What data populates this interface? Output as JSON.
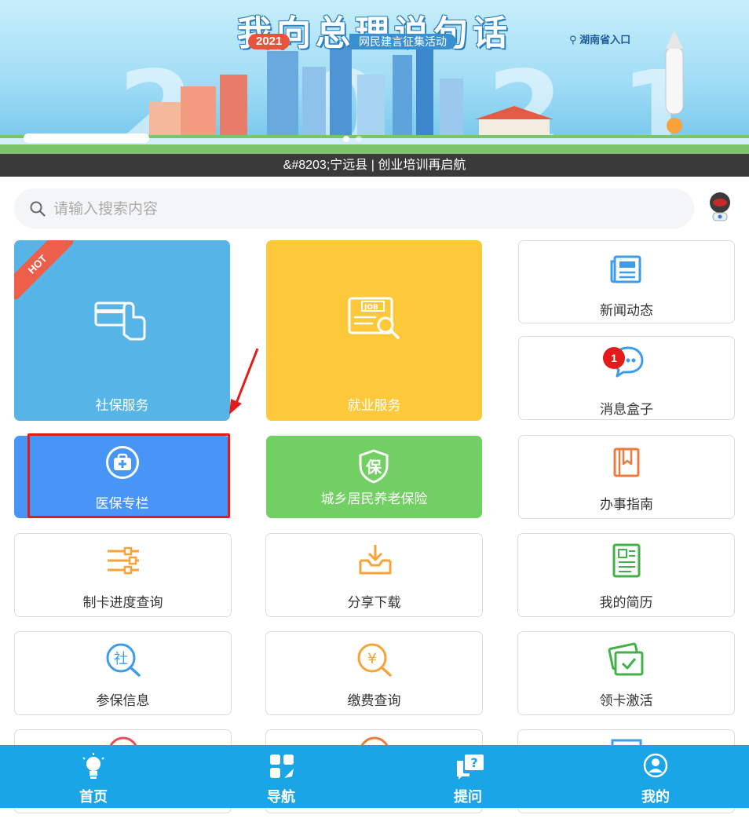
{
  "banner": {
    "title": "我向总理说句话",
    "year": "2021",
    "subtitle": "网民建言征集活动",
    "location": "湖南省入口",
    "slides": 2,
    "active_slide": 0
  },
  "news": {
    "text": "&#8203;宁远县 | 创业培训再启航"
  },
  "search": {
    "placeholder": "请输入搜索内容"
  },
  "tiles": {
    "shebao": {
      "label": "社保服务",
      "hot": "HOT"
    },
    "jiuye": {
      "label": "就业服务"
    },
    "news": {
      "label": "新闻动态"
    },
    "messages": {
      "label": "消息盒子",
      "badge": "1"
    },
    "yibao": {
      "label": "医保专栏"
    },
    "pension": {
      "label": "城乡居民养老保险",
      "icon_char": "保"
    },
    "guide": {
      "label": "办事指南"
    },
    "card_progress": {
      "label": "制卡进度查询"
    },
    "download": {
      "label": "分享下载"
    },
    "resume": {
      "label": "我的简历"
    },
    "insured_info": {
      "label": "参保信息",
      "icon_char": "社"
    },
    "payment": {
      "label": "缴费查询",
      "icon_char": "¥"
    },
    "card_activate": {
      "label": "领卡激活"
    }
  },
  "bottom_nav": {
    "items": [
      {
        "label": "首页"
      },
      {
        "label": "导航"
      },
      {
        "label": "提问"
      },
      {
        "label": "我的"
      }
    ]
  },
  "colors": {
    "accent_blue": "#1aa6e6",
    "tile_blue": "#56b5e6",
    "tile_yellow": "#fdc93a",
    "tile_darkblue": "#4795f6",
    "tile_green": "#72cf63",
    "highlight_red": "#e31b1b"
  }
}
